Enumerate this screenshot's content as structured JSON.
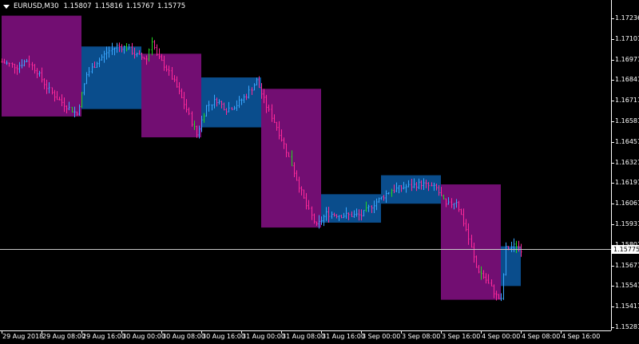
{
  "header": {
    "symbol": "EURUSD,M30",
    "open": "1.15807",
    "high": "1.15816",
    "low": "1.15767",
    "close": "1.15775"
  },
  "colors": {
    "background": "#000000",
    "up_box": "#0a4d8c",
    "down_box": "#720e72",
    "up_bar": "#3aa7ff",
    "down_bar": "#ff2a9a",
    "doji_bar": "#22d822",
    "axis": "#ffffff",
    "price_line": "#c8c8c8"
  },
  "price_axis": {
    "labels": [
      "1.17236",
      "1.17101",
      "1.16971",
      "1.16841",
      "1.16711",
      "1.16581",
      "1.16451",
      "1.16321",
      "1.16191",
      "1.16061",
      "1.15931",
      "1.15801",
      "1.15671",
      "1.15541",
      "1.15411",
      "1.15281"
    ],
    "current_price": "1.15775"
  },
  "time_axis": {
    "labels": [
      "29 Aug 2018",
      "29 Aug 08:00",
      "29 Aug 16:00",
      "30 Aug 00:00",
      "30 Aug 08:00",
      "30 Aug 16:00",
      "31 Aug 00:00",
      "31 Aug 08:00",
      "31 Aug 16:00",
      "3 Sep 00:00",
      "3 Sep 08:00",
      "3 Sep 16:00",
      "4 Sep 00:00",
      "4 Sep 08:00",
      "4 Sep 16:00"
    ]
  },
  "chart_data": {
    "type": "ohlc",
    "symbol": "EURUSD",
    "timeframe": "M30",
    "y_range": [
      1.15281,
      1.17236
    ],
    "current_price": 1.15775,
    "session_boxes": [
      {
        "start": "29 Aug 2018 00:00",
        "end": "29 Aug 2018 16:00",
        "direction": "down",
        "high": 1.17253,
        "low": 1.16615
      },
      {
        "start": "29 Aug 2018 16:00",
        "end": "30 Aug 2018 04:00",
        "direction": "up",
        "high": 1.17058,
        "low": 1.16662
      },
      {
        "start": "30 Aug 2018 04:00",
        "end": "30 Aug 2018 16:00",
        "direction": "down",
        "high": 1.17012,
        "low": 1.16483
      },
      {
        "start": "30 Aug 2018 16:00",
        "end": "31 Aug 2018 04:00",
        "direction": "up",
        "high": 1.16862,
        "low": 1.16546
      },
      {
        "start": "31 Aug 2018 04:00",
        "end": "31 Aug 2018 16:00",
        "direction": "down",
        "high": 1.1679,
        "low": 1.15912
      },
      {
        "start": "31 Aug 2018 16:00",
        "end": "3 Sep 2018 04:00",
        "direction": "up",
        "high": 1.16123,
        "low": 1.15943
      },
      {
        "start": "3 Sep 2018 04:00",
        "end": "3 Sep 2018 16:00",
        "direction": "up",
        "high": 1.16243,
        "low": 1.16063
      },
      {
        "start": "3 Sep 2018 16:00",
        "end": "4 Sep 2018 04:00",
        "direction": "down",
        "high": 1.16185,
        "low": 1.15455
      },
      {
        "start": "4 Sep 2018 04:00",
        "end": "4 Sep 2018 08:00",
        "direction": "up",
        "high": 1.15793,
        "low": 1.15542
      }
    ],
    "price_path": [
      [
        "29 Aug 2018 00:00",
        1.1696
      ],
      [
        "29 Aug 2018 03:00",
        1.1693
      ],
      [
        "29 Aug 2018 05:00",
        1.1697
      ],
      [
        "29 Aug 2018 07:00",
        1.169
      ],
      [
        "29 Aug 2018 09:00",
        1.168
      ],
      [
        "29 Aug 2018 11:00",
        1.1673
      ],
      [
        "29 Aug 2018 13:00",
        1.1668
      ],
      [
        "29 Aug 2018 15:00",
        1.1663
      ],
      [
        "29 Aug 2018 17:00",
        1.1688
      ],
      [
        "29 Aug 2018 19:00",
        1.1696
      ],
      [
        "29 Aug 2018 21:00",
        1.1702
      ],
      [
        "29 Aug 2018 23:00",
        1.1706
      ],
      [
        "30 Aug 2018 01:00",
        1.1705
      ],
      [
        "30 Aug 2018 03:00",
        1.17
      ],
      [
        "30 Aug 2018 05:00",
        1.1698
      ],
      [
        "30 Aug 2018 06:00",
        1.171
      ],
      [
        "30 Aug 2018 07:00",
        1.17
      ],
      [
        "30 Aug 2018 09:00",
        1.1692
      ],
      [
        "30 Aug 2018 11:00",
        1.168
      ],
      [
        "30 Aug 2018 13:00",
        1.1666
      ],
      [
        "30 Aug 2018 15:00",
        1.165
      ],
      [
        "30 Aug 2018 17:00",
        1.1668
      ],
      [
        "30 Aug 2018 19:00",
        1.1672
      ],
      [
        "30 Aug 2018 21:00",
        1.1666
      ],
      [
        "30 Aug 2018 23:00",
        1.1669
      ],
      [
        "31 Aug 2018 01:00",
        1.1675
      ],
      [
        "31 Aug 2018 03:00",
        1.1684
      ],
      [
        "31 Aug 2018 05:00",
        1.1668
      ],
      [
        "31 Aug 2018 07:00",
        1.1655
      ],
      [
        "31 Aug 2018 09:00",
        1.164
      ],
      [
        "31 Aug 2018 11:00",
        1.1622
      ],
      [
        "31 Aug 2018 13:00",
        1.1605
      ],
      [
        "31 Aug 2018 15:00",
        1.1592
      ],
      [
        "31 Aug 2018 17:00",
        1.16
      ],
      [
        "31 Aug 2018 20:00",
        1.1599
      ],
      [
        "3 Sep 2018 00:00",
        1.1599
      ],
      [
        "3 Sep 2018 02:00",
        1.1605
      ],
      [
        "3 Sep 2018 04:00",
        1.161
      ],
      [
        "3 Sep 2018 06:00",
        1.1615
      ],
      [
        "3 Sep 2018 09:00",
        1.1617
      ],
      [
        "3 Sep 2018 12:00",
        1.1619
      ],
      [
        "3 Sep 2018 15:00",
        1.1616
      ],
      [
        "3 Sep 2018 17:00",
        1.1605
      ],
      [
        "3 Sep 2018 19:00",
        1.1608
      ],
      [
        "3 Sep 2018 21:00",
        1.159
      ],
      [
        "3 Sep 2018 23:00",
        1.1566
      ],
      [
        "4 Sep 2018 01:00",
        1.1558
      ],
      [
        "4 Sep 2018 03:00",
        1.1548
      ],
      [
        "4 Sep 2018 04:00",
        1.1545
      ],
      [
        "4 Sep 2018 05:00",
        1.1578
      ],
      [
        "4 Sep 2018 07:00",
        1.158
      ],
      [
        "4 Sep 2018 08:00",
        1.15775
      ]
    ]
  }
}
